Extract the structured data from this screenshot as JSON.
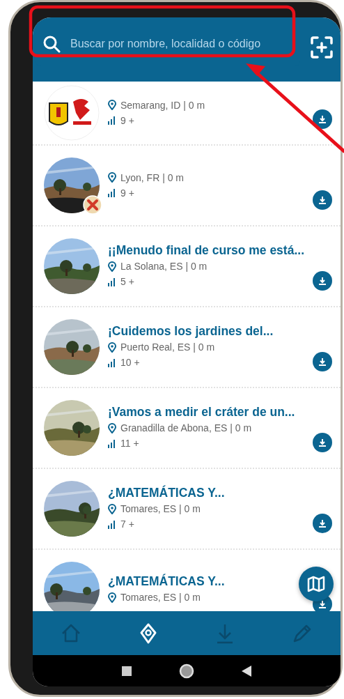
{
  "search": {
    "placeholder": "Buscar por nombre, localidad o código"
  },
  "items": [
    {
      "image": {
        "kind": "logo"
      },
      "location": "Semarang, ID | 0 m",
      "count": "9 +",
      "flagged": false
    },
    {
      "location": "Lyon, FR | 0 m",
      "count": "9 +",
      "flagged": true
    },
    {
      "title": "¡¡Menudo final de curso me está...",
      "location": "La Solana, ES | 0 m",
      "count": "5 +",
      "flagged": false
    },
    {
      "title": "¡Cuidemos los jardines del...",
      "location": "Puerto Real, ES | 0 m",
      "count": "10 +",
      "flagged": false
    },
    {
      "title": "¡Vamos a medir el cráter de un...",
      "location": "Granadilla de Abona, ES | 0 m",
      "count": "11 +",
      "flagged": false
    },
    {
      "title": "¿MATEMÁTICAS Y...",
      "location": "Tomares, ES | 0 m",
      "count": "7 +",
      "flagged": false
    },
    {
      "title": "¿MATEMÁTICAS Y...",
      "location": "Tomares, ES | 0 m",
      "flagged": false
    }
  ],
  "nav": [
    {
      "kind": "home",
      "selected": false
    },
    {
      "kind": "places",
      "selected": true
    },
    {
      "kind": "downloads",
      "selected": false
    },
    {
      "kind": "edit",
      "selected": false
    }
  ]
}
